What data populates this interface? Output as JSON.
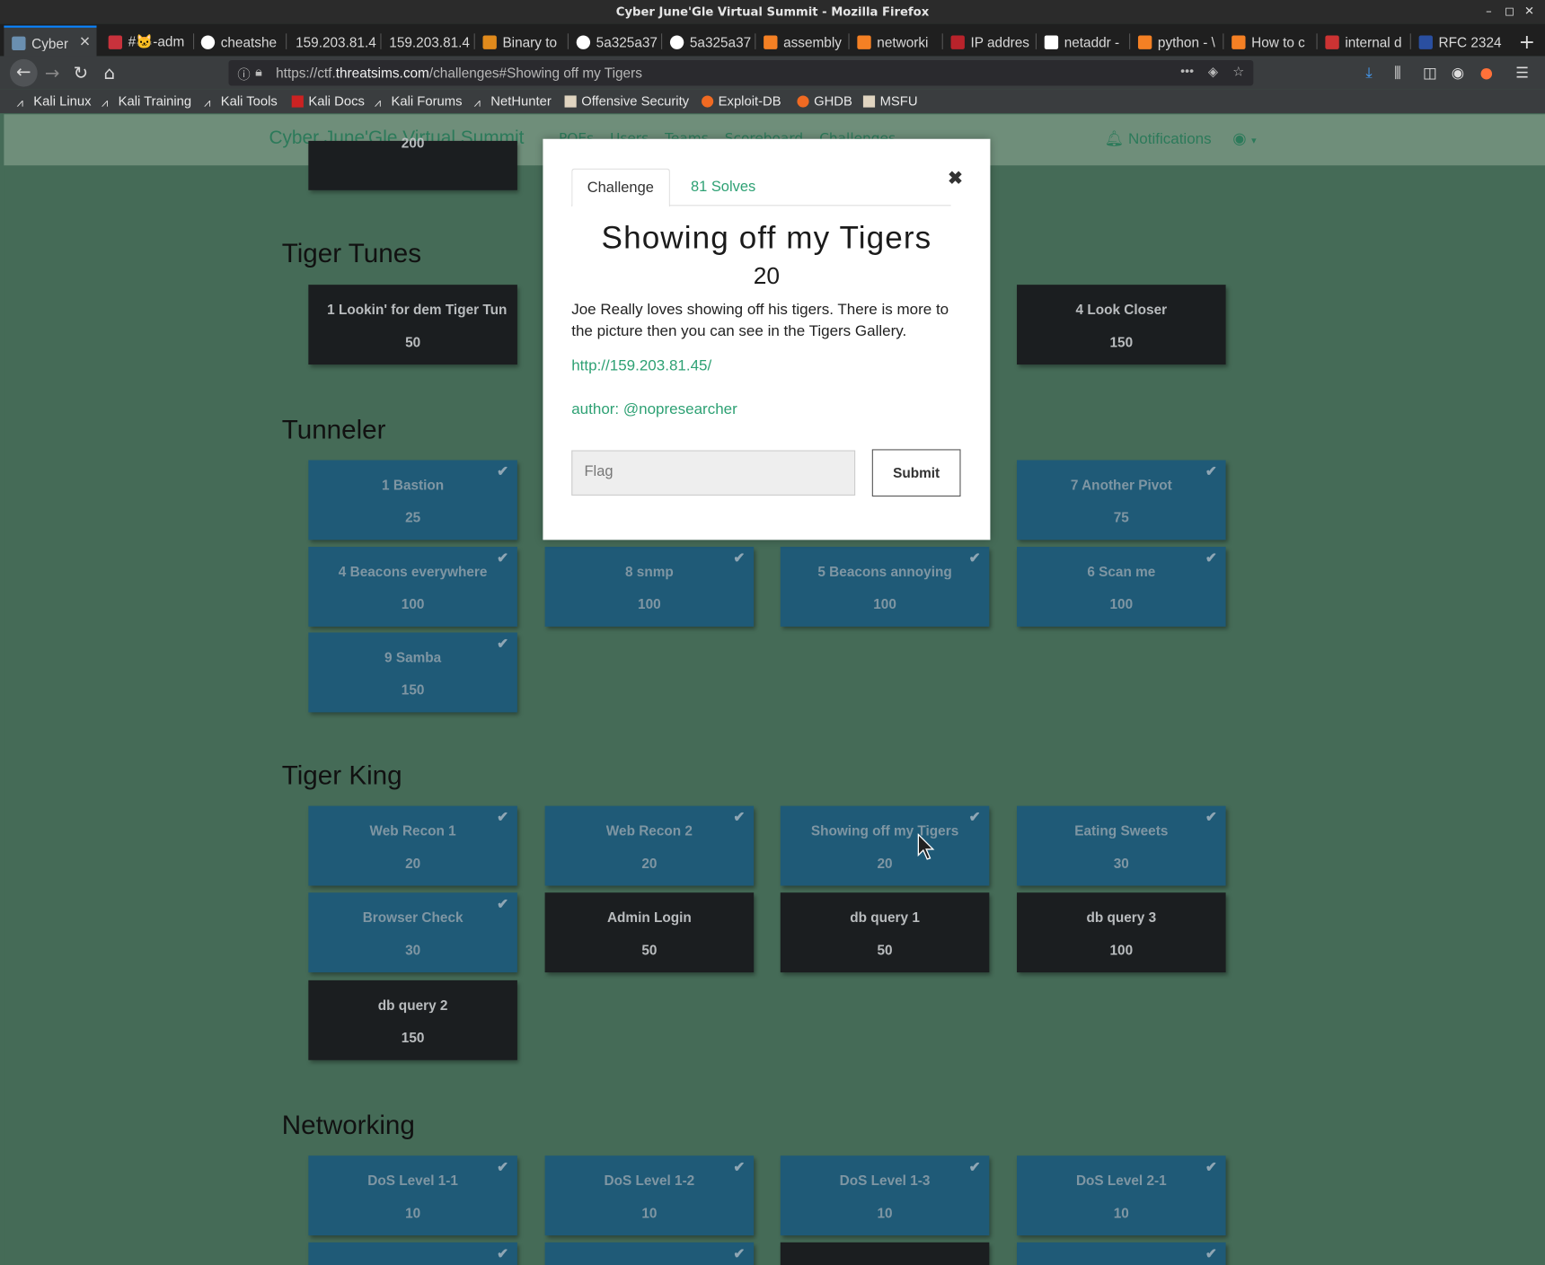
{
  "window": {
    "title": "Cyber June'Gle Virtual Summit - Mozilla Firefox",
    "controls": [
      "–",
      "◻",
      "✕"
    ]
  },
  "tabs": [
    {
      "label": "Cyber",
      "active": true
    },
    {
      "label": "#🐱-adm"
    },
    {
      "label": "cheatshe"
    },
    {
      "label": "159.203.81.4"
    },
    {
      "label": "159.203.81.4"
    },
    {
      "label": "Binary to"
    },
    {
      "label": "5a325a37"
    },
    {
      "label": "5a325a37"
    },
    {
      "label": "assembly"
    },
    {
      "label": "networki"
    },
    {
      "label": "IP addres"
    },
    {
      "label": "netaddr -"
    },
    {
      "label": "python - \\"
    },
    {
      "label": "How to c"
    },
    {
      "label": "internal d"
    },
    {
      "label": "RFC 2324"
    }
  ],
  "navbar": {
    "url_prefix": "https://ctf.",
    "url_domain": "threatsims.com",
    "url_path": "/challenges#Showing off my Tigers",
    "dots": "•••"
  },
  "bookmarks": [
    {
      "label": "Kali Linux"
    },
    {
      "label": "Kali Training"
    },
    {
      "label": "Kali Tools"
    },
    {
      "label": "Kali Docs"
    },
    {
      "label": "Kali Forums"
    },
    {
      "label": "NetHunter"
    },
    {
      "label": "Offensive Security"
    },
    {
      "label": "Exploit-DB"
    },
    {
      "label": "GHDB"
    },
    {
      "label": "MSFU"
    }
  ],
  "site": {
    "brand": "Cyber June'Gle Virtual Summit",
    "nav": [
      "POEs",
      "Users",
      "Teams",
      "Scoreboard",
      "Challenges"
    ],
    "notifications": "Notifications"
  },
  "categories": {
    "tiger_tunes": "Tiger Tunes",
    "tunneler": "Tunneler",
    "tiger_king": "Tiger King",
    "networking": "Networking"
  },
  "cards": {
    "top_partial": {
      "pts": "200"
    },
    "tt1": {
      "name": "1 Lookin' for dem Tiger Tun",
      "pts": "50"
    },
    "tt4": {
      "name": "4 Look Closer",
      "pts": "150"
    },
    "tn1": {
      "name": "1 Bastion",
      "pts": "25"
    },
    "tn7": {
      "name": "7 Another Pivot",
      "pts": "75"
    },
    "tn4": {
      "name": "4 Beacons everywhere",
      "pts": "100"
    },
    "tn8": {
      "name": "8 snmp",
      "pts": "100"
    },
    "tn5": {
      "name": "5 Beacons annoying",
      "pts": "100"
    },
    "tn6": {
      "name": "6 Scan me",
      "pts": "100"
    },
    "tn9": {
      "name": "9 Samba",
      "pts": "150"
    },
    "tk1": {
      "name": "Web Recon 1",
      "pts": "20"
    },
    "tk2": {
      "name": "Web Recon 2",
      "pts": "20"
    },
    "tk3": {
      "name": "Showing off my Tigers",
      "pts": "20"
    },
    "tk4": {
      "name": "Eating Sweets",
      "pts": "30"
    },
    "tk5": {
      "name": "Browser Check",
      "pts": "30"
    },
    "tk6": {
      "name": "Admin Login",
      "pts": "50"
    },
    "tk7": {
      "name": "db query 1",
      "pts": "50"
    },
    "tk8": {
      "name": "db query 3",
      "pts": "100"
    },
    "tk9": {
      "name": "db query 2",
      "pts": "150"
    },
    "nw1": {
      "name": "DoS Level 1-1",
      "pts": "10"
    },
    "nw2": {
      "name": "DoS Level 1-2",
      "pts": "10"
    },
    "nw3": {
      "name": "DoS Level 1-3",
      "pts": "10"
    },
    "nw4": {
      "name": "DoS Level 2-1",
      "pts": "10"
    }
  },
  "modal": {
    "tab_challenge": "Challenge",
    "tab_solves": "81 Solves",
    "title": "Showing off my Tigers",
    "value": "20",
    "description": "Joe Really loves showing off his tigers. There is more to the picture then you can see in the Tigers Gallery.",
    "link": "http://159.203.81.45/",
    "author": "author: @nopresearcher",
    "flag_placeholder": "Flag",
    "submit": "Submit"
  },
  "colors": {
    "solved": "#1f5a77",
    "unsolved": "#1b1e20",
    "accent": "#2ea174"
  }
}
